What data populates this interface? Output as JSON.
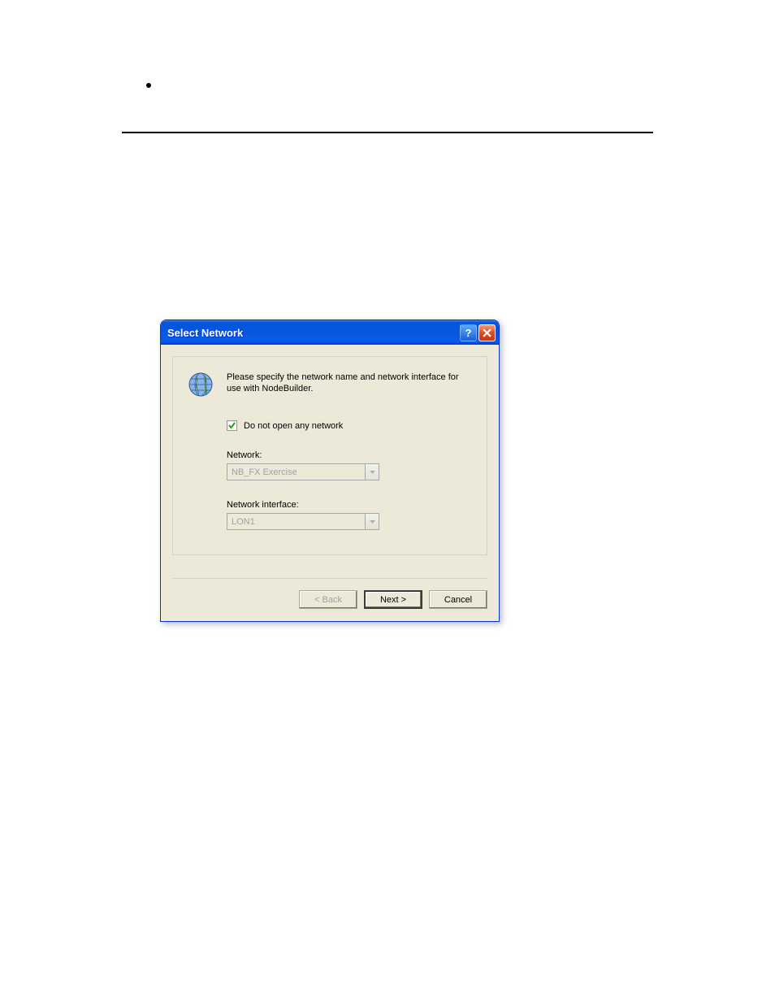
{
  "dialog": {
    "title": "Select Network",
    "instruction": "Please specify the network name and network interface for use with NodeBuilder.",
    "checkbox_label": "Do not open any network",
    "checkbox_checked": true,
    "fields": {
      "network": {
        "label": "Network:",
        "value": "NB_FX Exercise"
      },
      "interface": {
        "label": "Network interface:",
        "value": "LON1"
      }
    },
    "buttons": {
      "back": "< Back",
      "next": "Next >",
      "cancel": "Cancel"
    }
  }
}
